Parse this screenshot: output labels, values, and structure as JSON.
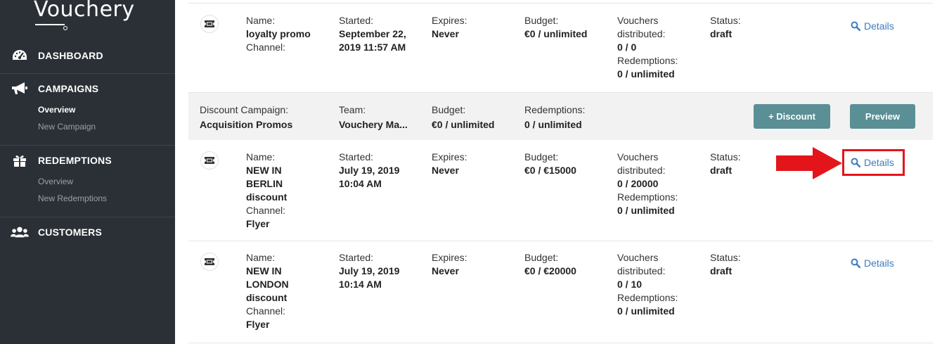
{
  "sidebar": {
    "logo": "Vouchery",
    "nav": [
      {
        "label": "DASHBOARD",
        "icon": "dashboard-icon"
      },
      {
        "label": "CAMPAIGNS",
        "icon": "megaphone-icon",
        "subs": [
          "Overview",
          "New Campaign"
        ]
      },
      {
        "label": "REDEMPTIONS",
        "icon": "gift-icon",
        "subs": [
          "Overview",
          "New Redemptions"
        ]
      },
      {
        "label": "CUSTOMERS",
        "icon": "users-icon"
      }
    ]
  },
  "labels": {
    "name": "Name:",
    "channel": "Channel:",
    "started": "Started:",
    "expires": "Expires:",
    "budget": "Budget:",
    "vouchers": "Vouchers",
    "distributed": "distributed:",
    "redemptions": "Redemptions:",
    "status": "Status:",
    "details": "Details"
  },
  "rows": [
    {
      "name_lines": [
        "loyalty promo"
      ],
      "channel": "",
      "started_lines": [
        "September 22,",
        "2019 11:57 AM"
      ],
      "expires": "Never",
      "budget": "€0 / unlimited",
      "distributed": "0 / 0",
      "redemptions": "0 / unlimited",
      "status": "draft"
    },
    {
      "name_lines": [
        "NEW IN",
        "BERLIN",
        "discount"
      ],
      "channel": "Flyer",
      "started_lines": [
        "July 19, 2019",
        "10:04 AM"
      ],
      "expires": "Never",
      "budget": "€0 / €15000",
      "distributed": "0 / 20000",
      "redemptions": "0 / unlimited",
      "status": "draft"
    },
    {
      "name_lines": [
        "NEW IN",
        "LONDON",
        "discount"
      ],
      "channel": "Flyer",
      "started_lines": [
        "July 19, 2019",
        "10:14 AM"
      ],
      "expires": "Never",
      "budget": "€0 / €20000",
      "distributed": "0 / 10",
      "redemptions": "0 / unlimited",
      "status": "draft"
    }
  ],
  "campaign": {
    "type_label": "Discount Campaign:",
    "name": "Acquisition Promos",
    "team_label": "Team:",
    "team": "Vouchery Ma...",
    "budget_label": "Budget:",
    "budget": "€0 / unlimited",
    "redemptions_label": "Redemptions:",
    "redemptions": "0 / unlimited",
    "add_discount_button": "+ Discount",
    "preview_button": "Preview"
  },
  "colors": {
    "sidebar_bg": "#2b3036",
    "accent_button": "#5a8f96",
    "link": "#3a7bbf",
    "annotation_red": "#e3151a"
  }
}
